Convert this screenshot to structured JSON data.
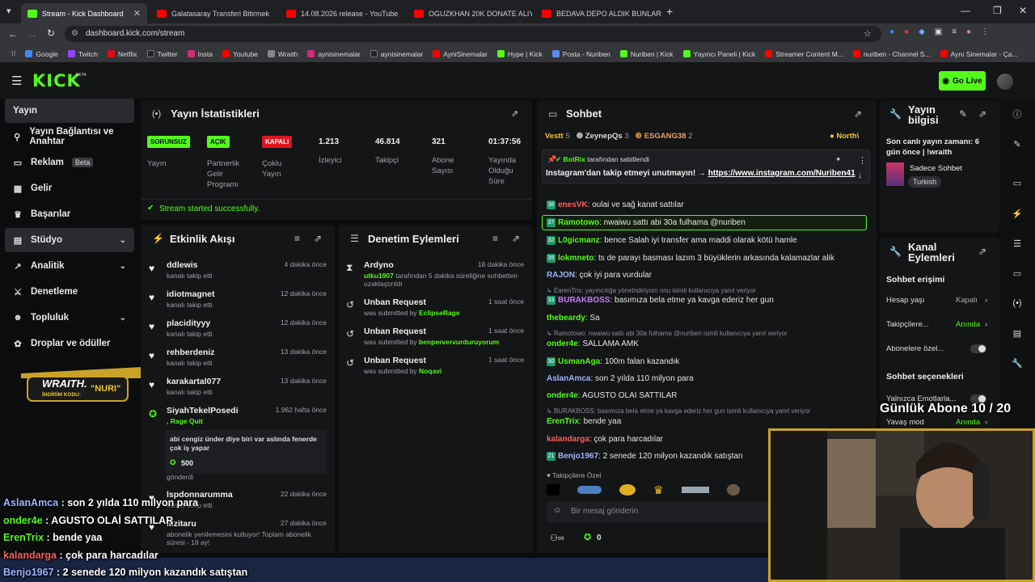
{
  "browser": {
    "tabs": [
      {
        "label": "Stream - Kick Dashboard",
        "color": "#53fc18"
      },
      {
        "label": "Galatasaray Transferi Bitirmek",
        "color": "#ff0000"
      },
      {
        "label": "14.08.2026 release - YouTube",
        "color": "#ff0000"
      },
      {
        "label": "OGUZKHAN 20K DONATE ALIYOR",
        "color": "#ff0000"
      },
      {
        "label": "BEDAVA DEPO ALDIK BUNLAR ÇI",
        "color": "#ff0000"
      }
    ],
    "url": "dashboard.kick.com/stream",
    "bookmarks": [
      "Google",
      "Twitch",
      "Netflix",
      "Twitter",
      "Insta",
      "Youtube",
      "Wraith",
      "aynisinemalar",
      "aynisinemalar",
      "AyniSinemalar",
      "Hype | Kick",
      "Posta - Nuriben",
      "Nuriben | Kick",
      "Yayıncı Paneli | Kick",
      "Streamer Content M...",
      "nuriben - Channel S...",
      "Aynı Sinemalar - Ça..."
    ]
  },
  "header": {
    "logo": "KICK",
    "logo_tag": "BETA",
    "go_live": "Go Live"
  },
  "sidebar": {
    "items": [
      {
        "label": "Yayın"
      },
      {
        "label": "Yayın Bağlantısı ve Anahtar"
      },
      {
        "label": "Reklam",
        "badge": "Beta"
      },
      {
        "label": "Gelir"
      },
      {
        "label": "Başarılar"
      },
      {
        "label": "Stüdyo"
      },
      {
        "label": "Analitik"
      },
      {
        "label": "Denetleme"
      },
      {
        "label": "Topluluk"
      },
      {
        "label": "Droplar ve ödüller"
      }
    ],
    "promo": {
      "brand": "WRAITH.",
      "code_label": "İNDİRİM KODU:",
      "code": "\"NURI\""
    }
  },
  "stats": {
    "title": "Yayın İstatistikleri",
    "items": [
      {
        "badge": "SORUNSUZ",
        "label": "Yayın"
      },
      {
        "badge": "AÇIK",
        "label": "Partnerlik Gelir Programı"
      },
      {
        "badge": "KAPALI",
        "label": "Çoklu Yayın"
      },
      {
        "value": "1.213",
        "label": "İzleyici"
      },
      {
        "value": "46.814",
        "label": "Takipçi"
      },
      {
        "value": "321",
        "label": "Abone Sayısı"
      },
      {
        "value": "01:37:56",
        "label": "Yayında Olduğu Süre"
      }
    ],
    "status": "Stream started successfully."
  },
  "activity": {
    "title": "Etkinlik Akışı",
    "items": [
      {
        "name": "ddlewis",
        "sub": "kanalı takip etti",
        "time": "4 dakika önce"
      },
      {
        "name": "idiotmagnet",
        "sub": "kanalı takip etti",
        "time": "12 dakika önce"
      },
      {
        "name": "placidityyy",
        "sub": "kanalı takip etti",
        "time": "12 dakika önce"
      },
      {
        "name": "rehberdeniz",
        "sub": "kanalı takip etti",
        "time": "13 dakika önce"
      },
      {
        "name": "karakartal077",
        "sub": "kanalı takip etti",
        "time": "13 dakika önce"
      },
      {
        "name": "SiyahTekelPosedi",
        "sub": ", Rage Quit",
        "time": "1.962 hafta önce",
        "message": "abi cengiz ünder diye biri var aslında fenerde çok iş yapar",
        "amount": "500",
        "footer": "gönderdi"
      },
      {
        "name": "lspdonnarumma",
        "sub": "kanalı takip etti",
        "time": "22 dakika önce"
      },
      {
        "name": "Mzitaru",
        "sub": "abonelik yenilemesini kutluyor! Toplam abonelik süresi - 18 ay!",
        "time": "27 dakika önce"
      }
    ]
  },
  "moderation": {
    "title": "Denetim Eylemleri",
    "items": [
      {
        "title": "Ardyno",
        "user": "utku1907",
        "desc": "tarafından 5 dakika süreliğine sohbetten uzaklaştırıldı",
        "time": "18 dakika önce"
      },
      {
        "title": "Unban Request",
        "desc": "was submitted by",
        "user": "EclipseRage",
        "time": "1 saat önce"
      },
      {
        "title": "Unban Request",
        "desc": "was submitted by",
        "user": "benpervervurduruyorum",
        "time": "1 saat önce"
      },
      {
        "title": "Unban Request",
        "desc": "was submitted by",
        "user": "Noqavi",
        "time": "1 saat önce"
      }
    ]
  },
  "chat": {
    "title": "Sohbet",
    "leaderboard": [
      {
        "name": "Vestt",
        "count": "5"
      },
      {
        "name": "ZeynepQs",
        "count": "3"
      },
      {
        "name": "ESGANG38",
        "count": "2"
      },
      {
        "name": "North\\"
      }
    ],
    "pinned": {
      "by": "BotRix",
      "by_suffix": "tarafından sabitlendi",
      "text": "Instagram'dan takip etmeyi unutmayın! →",
      "link": "https://www.instagram.com/Nuriben41"
    },
    "messages": [
      {
        "user": "enesVK",
        "color": "#ff5c5c",
        "text": "oulai ve sağ kanat sattılar"
      },
      {
        "user": "Ramotowo",
        "color": "#53fc18",
        "text": "nwaiwu sattı abi 30a fulhama @nuriben",
        "highlight": true
      },
      {
        "user": "L0gicmanz",
        "color": "#53fc18",
        "text": "bence Salah iyi transfer ama maddi olarak kötü hamle"
      },
      {
        "user": "lokmneto",
        "color": "#53fc18",
        "text": "ts de parayı basması lazım 3 büyüklerin arkasında kalamazlar alik"
      },
      {
        "user": "RAJON",
        "color": "#9db4ff",
        "text": "çok iyi para vurdular"
      },
      {
        "reply": "EarenTrix: yayıncılığa yönelndiriyom onu isimli kullanıcıya yanıt veriyor"
      },
      {
        "user": "BURAKBOSS",
        "color": "#c879ff",
        "text": "basımıza bela etme ya kavga ederiz her gun"
      },
      {
        "user": "thebeardy",
        "color": "#53fc18",
        "text": "Sa"
      },
      {
        "reply": "Ramotowo: nwaiwu sattı abi 30a fulhama @nuriben isimli kullanıcıya yanıt veriyor"
      },
      {
        "user": "onder4e",
        "color": "#53fc18",
        "text": "SALLAMA AMK"
      },
      {
        "user": "UsmanAga",
        "color": "#53fc18",
        "text": "100m falan kazandık"
      },
      {
        "user": "AslanAmca",
        "color": "#9db4ff",
        "text": "son 2 yılda 110 milyon para"
      },
      {
        "user": "onder4e",
        "color": "#53fc18",
        "text": "AGUSTO OLAİ SATTILAR"
      },
      {
        "reply": "BURAKBOSS: basımıza bela etme ya kavga ederiz her gun isimli kullanıcıya yanıt veriyor"
      },
      {
        "user": "ErenTrix",
        "color": "#53fc18",
        "text": "bende yaa"
      },
      {
        "user": "kalandarga",
        "color": "#ff5c5c",
        "text": "çok para harcadılar"
      },
      {
        "user": "Benjo1967",
        "color": "#9db4ff",
        "text": "2 senede 120 milyon kazandık satıştan"
      }
    ],
    "emote_label": "Takipçilere Özel",
    "input_placeholder": "Bir mesaj gönderin",
    "points": "0"
  },
  "stream_info": {
    "title": "Yayın bilgisi",
    "last": "Son canlı yayın zamanı: 6 gün önce | !wraith",
    "category": "Sadece Sohbet",
    "tag": "Turkish"
  },
  "channel_actions": {
    "title": "Kanal Eylemleri",
    "section1": "Sohbet erişimi",
    "rows": [
      {
        "label": "Hesap yaşı",
        "value": "Kapalı"
      },
      {
        "label": "Takipçilere...",
        "value": "Anında"
      },
      {
        "label": "Abonelere özel..."
      }
    ],
    "section2": "Sohbet seçenekleri",
    "rows2": [
      {
        "label": "Yalnızca Emotlarla..."
      },
      {
        "label": "Yavaş mod",
        "value": "Anında"
      }
    ]
  },
  "overlay": {
    "sub_goal": "Günlük Abone 10 / 20",
    "chat": [
      {
        "user": "AslanAmca",
        "color": "#9db4ff",
        "text": ": son 2 yılda 110 milyon para"
      },
      {
        "user": "onder4e",
        "color": "#53fc18",
        "text": ": AGUSTO OLAİ SATTILAR"
      },
      {
        "user": "ErenTrix",
        "color": "#53fc18",
        "text": ": bende yaa"
      },
      {
        "user": "kalandarga",
        "color": "#ff5c5c",
        "text": ": çok para harcadılar"
      },
      {
        "user": "Benjo1967",
        "color": "#9db4ff",
        "text": ": 2 senede 120 milyon kazandık satıştan"
      }
    ]
  }
}
